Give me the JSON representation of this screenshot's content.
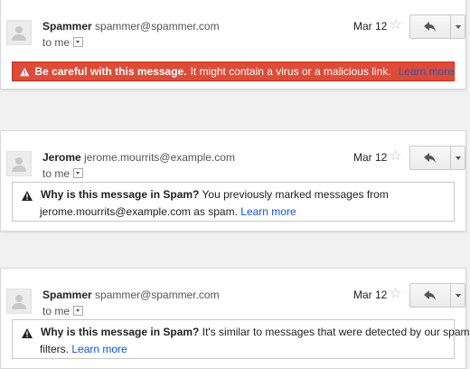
{
  "messages": [
    {
      "sender_name": "Spammer",
      "sender_email": "spammer@spammer.com",
      "to_label": "to me",
      "date": "Mar 12",
      "warning": {
        "style": "red",
        "bold": "Be careful with this message.",
        "text": "It might contain a virus or a malicious link.",
        "link": "Learn more"
      }
    },
    {
      "sender_name": "Jerome",
      "sender_email": "jerome.mourrits@example.com",
      "to_label": "to me",
      "date": "Mar 12",
      "warning": {
        "style": "box",
        "bold": "Why is this message in Spam?",
        "text_line1": "You previously marked messages from",
        "text_line2": "jerome.mourrits@example.com as spam.",
        "link": "Learn more"
      }
    },
    {
      "sender_name": "Spammer",
      "sender_email": "spammer@spammer.com",
      "to_label": "to me",
      "date": "Mar 12",
      "warning": {
        "style": "box",
        "bold": "Why is this message in Spam?",
        "text_line1": "It's similar to messages that were detected by our spam",
        "text_line2": "filters.",
        "link": "Learn more"
      }
    }
  ],
  "icons": {
    "avatar": "person-icon",
    "star": "star-icon",
    "reply": "reply-arrow-icon",
    "more": "chevron-down-icon",
    "warning": "warning-triangle-icon"
  },
  "colors": {
    "danger_banner": "#dd4b39",
    "link": "#1155cc"
  }
}
